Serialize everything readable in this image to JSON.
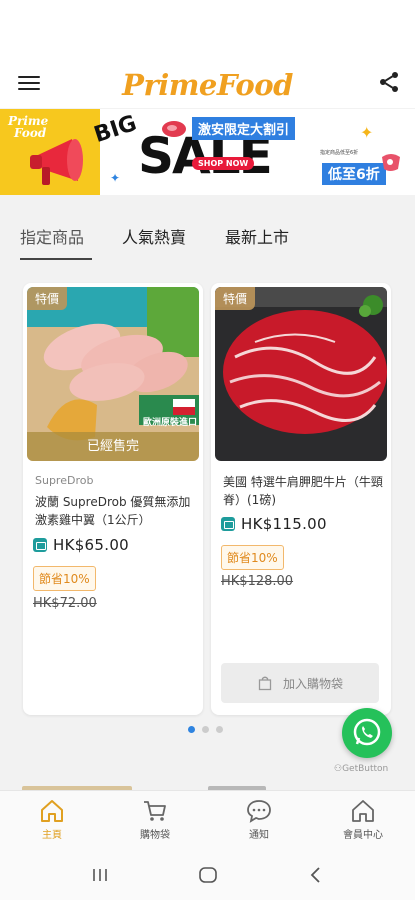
{
  "app": {
    "logo": "PrimeFood",
    "accent": "#f0a020"
  },
  "banner": {
    "brand_line1": "Prime",
    "brand_line2": "Food",
    "big": "BIG",
    "sale": "SALE",
    "shop_now": "SHOP NOW",
    "promo": "激安限定大割引",
    "small_note": "指定商品低至6折",
    "discount": "低至6折"
  },
  "tabs": [
    {
      "label": "指定商品",
      "active": true
    },
    {
      "label": "人氣熱賣",
      "active": false
    },
    {
      "label": "最新上市",
      "active": false
    }
  ],
  "products": [
    {
      "badge": "特價",
      "sold_out": "已經售完",
      "image_caption": "歐洲原裝進口",
      "brand": "SupreDrob",
      "title": "波蘭 SupreDrob 優質無添加激素雞中翼（1公斤）",
      "price": "HK$65.00",
      "save": "節省10%",
      "old_price": "HK$72.00"
    },
    {
      "badge": "特價",
      "title": "美國 特選牛肩胛肥牛片（牛頸脊）(1磅)",
      "price": "HK$115.00",
      "save": "節省10%",
      "old_price": "HK$128.00",
      "cart_label": "加入購物袋"
    }
  ],
  "carousel": {
    "pages": 3,
    "active": 0
  },
  "widget": {
    "getbutton": "GetButton"
  },
  "bottom_nav": [
    {
      "label": "主頁",
      "icon": "home-icon",
      "active": true
    },
    {
      "label": "購物袋",
      "icon": "cart-icon",
      "active": false
    },
    {
      "label": "通知",
      "icon": "chat-icon",
      "active": false
    },
    {
      "label": "會員中心",
      "icon": "member-home-icon",
      "active": false
    }
  ]
}
